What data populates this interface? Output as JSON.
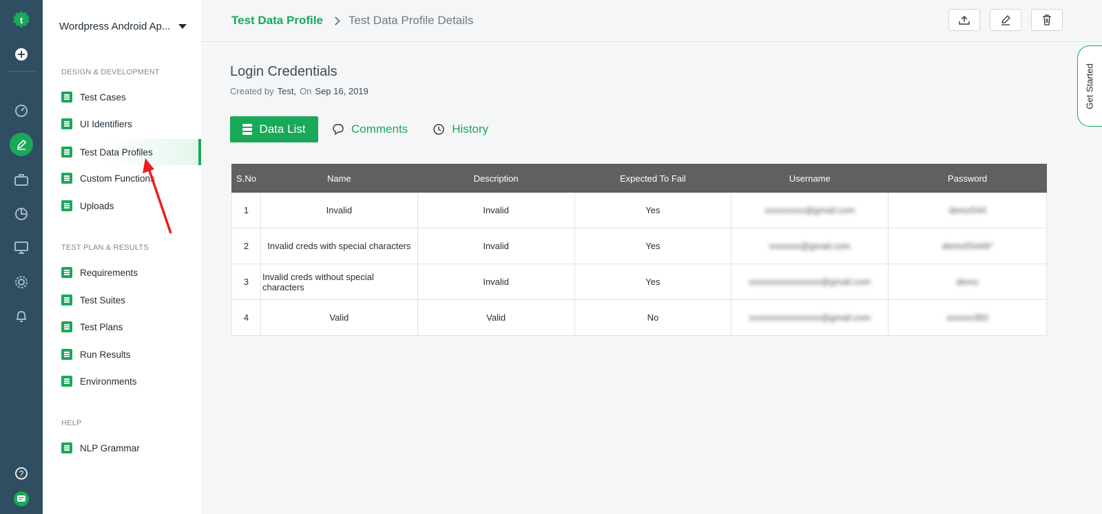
{
  "sidebar": {
    "project": "Wordpress Android Ap...",
    "sections": {
      "design": "DESIGN & DEVELOPMENT",
      "plan": "TEST PLAN & RESULTS",
      "help": "HELP"
    },
    "items": [
      {
        "label": "Test Cases"
      },
      {
        "label": "UI Identifiers"
      },
      {
        "label": "Test Data Profiles"
      },
      {
        "label": "Custom Functions"
      },
      {
        "label": "Uploads"
      },
      {
        "label": "Requirements"
      },
      {
        "label": "Test Suites"
      },
      {
        "label": "Test Plans"
      },
      {
        "label": "Run Results"
      },
      {
        "label": "Environments"
      },
      {
        "label": "NLP Grammar"
      }
    ]
  },
  "header": {
    "breadcrumb_root": "Test Data Profile",
    "breadcrumb_current": "Test Data Profile Details"
  },
  "get_started": "Get Started",
  "profile": {
    "title": "Login Credentials",
    "created_by_label": "Created by",
    "author": "Test,",
    "on_label": "On",
    "date": "Sep 16, 2019"
  },
  "tabs": {
    "data_list": "Data List",
    "comments": "Comments",
    "history": "History"
  },
  "table": {
    "headers": [
      "S.No",
      "Name",
      "Description",
      "Expected To Fail",
      "Username",
      "Password"
    ],
    "rows": [
      [
        "1",
        "Invalid",
        "Invalid",
        "Yes",
        "xxxxxxxxx@gmail.com",
        "demo544"
      ],
      [
        "2",
        "Invalid creds with special characters",
        "Invalid",
        "Yes",
        "xxxxxxx@gmail.com",
        "demo55449*"
      ],
      [
        "3",
        "Invalid creds without special characters",
        "Invalid",
        "Yes",
        "xxxxxxxxxxxxxxxx@gmail.com",
        "demo"
      ],
      [
        "4",
        "Valid",
        "Valid",
        "No",
        "xxxxxxxxxxxxxxxx@gmail.com",
        "xxxxxx383"
      ]
    ]
  }
}
